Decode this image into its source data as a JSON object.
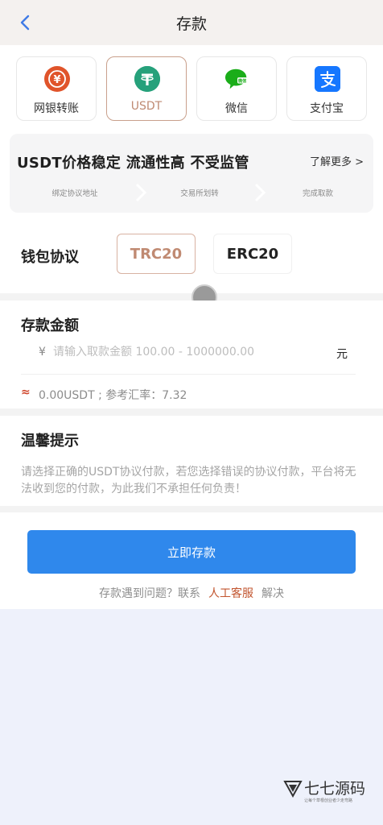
{
  "header": {
    "title": "存款",
    "back_icon": "chevron-left-icon"
  },
  "payment_methods": [
    {
      "label": "网银转账",
      "icon": "bank-transfer-icon",
      "color": "#e0542b",
      "selected": false
    },
    {
      "label": "USDT",
      "icon": "usdt-tether-icon",
      "color": "#26a17b",
      "selected": true
    },
    {
      "label": "微信",
      "icon": "wechat-icon",
      "color": "#1aad19",
      "selected": false
    },
    {
      "label": "支付宝",
      "icon": "alipay-icon",
      "color": "#1677ff",
      "selected": false
    }
  ],
  "banner": {
    "title": "USDT价格稳定 流通性高 不受监管",
    "more": "了解更多 >",
    "steps": [
      "绑定协议地址",
      "交易所划转",
      "完成取款"
    ]
  },
  "protocol": {
    "label": "钱包协议",
    "options": [
      "TRC20",
      "ERC20"
    ],
    "selected": "TRC20"
  },
  "amount": {
    "title": "存款金额",
    "currency_symbol": "¥",
    "placeholder": "请输入取款金额 100.00 - 1000000.00",
    "unit": "元",
    "approx_symbol": "≈",
    "conversion": "0.00USDT ; 参考汇率：7.32"
  },
  "tip": {
    "title": "温馨提示",
    "text": "请选择正确的USDT协议付款，若您选择错误的协议付款，平台将无法收到您的付款，为此我们不承担任何负责！"
  },
  "action": {
    "submit": "立即存款",
    "help_prefix": "存款遇到问题？联系",
    "help_link": "人工客服",
    "help_suffix": "解决"
  },
  "watermark": {
    "name": "七七源码",
    "tagline": "让每个草根创业者少走弯路"
  },
  "colors": {
    "accent_blue": "#2f88ec",
    "selected_brown": "#c08a72",
    "link_red": "#c2552f"
  }
}
